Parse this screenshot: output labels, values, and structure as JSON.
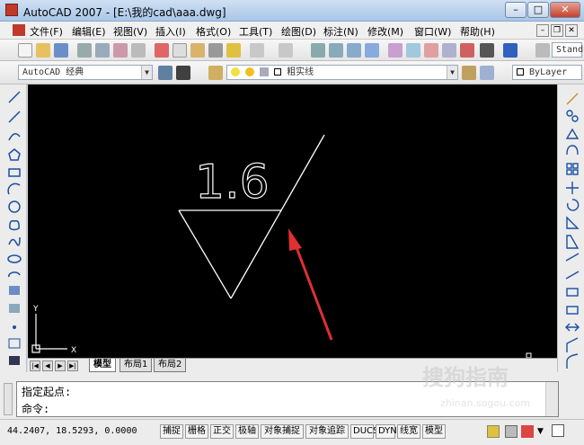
{
  "window": {
    "title": "AutoCAD 2007 - [E:\\我的cad\\aaa.dwg]",
    "min": "–",
    "max": "□",
    "close": "✕"
  },
  "menu": [
    "文件(F)",
    "编辑(E)",
    "视图(V)",
    "插入(I)",
    "格式(O)",
    "工具(T)",
    "绘图(D)",
    "标注(N)",
    "修改(M)",
    "窗口(W)",
    "帮助(H)"
  ],
  "toolbar": {
    "style_combo": "Stand"
  },
  "toolbar2": {
    "workspace": "AutoCAD 经典",
    "layer": "粗实线",
    "bylayer": "ByLayer"
  },
  "drawing": {
    "roughness_text": "1.6",
    "ucs_x": "X",
    "ucs_y": "Y"
  },
  "tabs": [
    "模型",
    "布局1",
    "布局2"
  ],
  "command": {
    "line1": "指定起点:",
    "line2": "命令:"
  },
  "status": {
    "coords": "44.2407, 18.5293, 0.0000",
    "buttons": [
      "捕捉",
      "栅格",
      "正交",
      "极轴",
      "对象捕捉",
      "对象追踪",
      "DUCS",
      "DYN",
      "线宽",
      "模型"
    ]
  },
  "watermark": {
    "main": "搜狗指南",
    "sub": "zhinan.sogou.com"
  },
  "colors": {
    "canvas": "#000000",
    "entity": "#ffffff",
    "arrow": "#e03030"
  }
}
